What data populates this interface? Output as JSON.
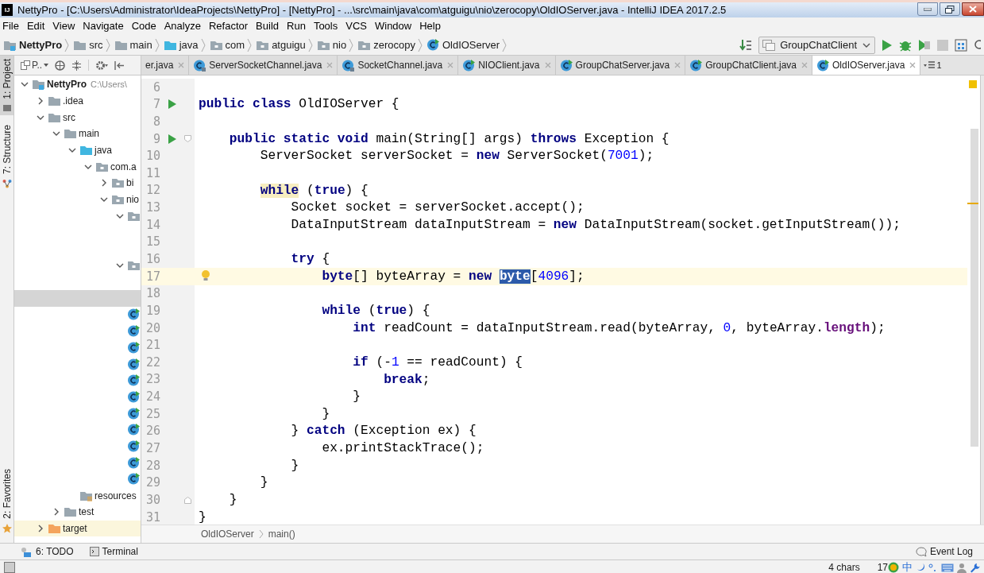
{
  "window": {
    "logo": "IJ",
    "title": "NettyPro - [C:\\Users\\Administrator\\IdeaProjects\\NettyPro] - [NettyPro] - ...\\src\\main\\java\\com\\atguigu\\nio\\zerocopy\\OldIOServer.java - IntelliJ IDEA 2017.2.5"
  },
  "menu": [
    "File",
    "Edit",
    "View",
    "Navigate",
    "Code",
    "Analyze",
    "Refactor",
    "Build",
    "Run",
    "Tools",
    "VCS",
    "Window",
    "Help"
  ],
  "nav_bar": {
    "crumbs": [
      {
        "label": "NettyPro",
        "kind": "project"
      },
      {
        "label": "src",
        "kind": "folder"
      },
      {
        "label": "main",
        "kind": "folder"
      },
      {
        "label": "java",
        "kind": "source"
      },
      {
        "label": "com",
        "kind": "package"
      },
      {
        "label": "atguigu",
        "kind": "package"
      },
      {
        "label": "nio",
        "kind": "package"
      },
      {
        "label": "zerocopy",
        "kind": "package"
      },
      {
        "label": "OldIOServer",
        "kind": "class"
      }
    ],
    "run_config": "GroupChatClient"
  },
  "tool_strip": {
    "top": [
      {
        "label": "1: Project",
        "selected": true,
        "kind": "project"
      },
      {
        "label": "7: Structure",
        "selected": false,
        "kind": "structure"
      }
    ],
    "bottom": [
      {
        "label": "2: Favorites",
        "selected": false,
        "kind": "favorites"
      }
    ]
  },
  "project_panel": {
    "view_label": "P..",
    "tree": [
      {
        "label": "NettyPro",
        "note": "C:\\Users\\",
        "kind": "project",
        "expanded": true,
        "selected": false,
        "children": [
          {
            "label": ".idea",
            "kind": "folder",
            "expanded": false,
            "selected": false
          },
          {
            "label": "src",
            "kind": "folder",
            "expanded": true,
            "selected": false,
            "children": [
              {
                "label": "main",
                "kind": "folder",
                "expanded": true,
                "selected": false,
                "children": [
                  {
                    "label": "java",
                    "kind": "source",
                    "expanded": true,
                    "selected": false,
                    "children": [
                      {
                        "label": "com.a",
                        "kind": "package",
                        "expanded": true,
                        "selected": false,
                        "children": [
                          {
                            "label": "bi",
                            "kind": "package",
                            "expanded": false,
                            "selected": false
                          },
                          {
                            "label": "nio",
                            "kind": "package",
                            "expanded": true,
                            "selected": false,
                            "children": [
                              {
                                "kind": "package",
                                "expanded": true,
                                "selected": false,
                                "children": [
                                  {
                                    "selected": false
                                  },
                                  {
                                    "selected": false
                                  }
                                ]
                              },
                              {
                                "kind": "package",
                                "expanded": true,
                                "selected": false,
                                "children": [
                                  {
                                    "selected": false
                                  },
                                  {
                                    "selected": true
                                  }
                                ]
                              },
                              {
                                "kind": "class",
                                "selected": false
                              },
                              {
                                "kind": "class",
                                "selected": false
                              },
                              {
                                "kind": "class",
                                "selected": false
                              },
                              {
                                "kind": "class",
                                "selected": false
                              },
                              {
                                "kind": "class",
                                "selected": false
                              },
                              {
                                "kind": "class",
                                "selected": false
                              },
                              {
                                "kind": "class",
                                "selected": false
                              },
                              {
                                "kind": "class",
                                "selected": false
                              },
                              {
                                "kind": "class",
                                "selected": false
                              },
                              {
                                "kind": "class",
                                "selected": false
                              },
                              {
                                "kind": "class",
                                "selected": false
                              }
                            ]
                          }
                        ]
                      }
                    ]
                  },
                  {
                    "label": "resources",
                    "kind": "resources",
                    "selected": false
                  }
                ]
              },
              {
                "label": "test",
                "kind": "folder",
                "expanded": false,
                "selected": false
              }
            ]
          },
          {
            "label": "target",
            "kind": "excluded",
            "expanded": false,
            "selected": false
          }
        ]
      }
    ]
  },
  "tabs": [
    {
      "label": "er.java",
      "selected": false
    },
    {
      "label": "ServerSocketChannel.java",
      "kind": "library",
      "selected": false
    },
    {
      "label": "SocketChannel.java",
      "kind": "library",
      "selected": false
    },
    {
      "label": "NIOClient.java",
      "kind": "runnable",
      "selected": false
    },
    {
      "label": "GroupChatServer.java",
      "kind": "runnable",
      "selected": false
    },
    {
      "label": "GroupChatClient.java",
      "kind": "runnable",
      "selected": false
    },
    {
      "label": "OldIOServer.java",
      "kind": "runnable",
      "selected": true
    }
  ],
  "tab_overflow": "1",
  "editor": {
    "lines": [
      {
        "number": "6",
        "current": false,
        "run": false,
        "fold_start": false,
        "fold_end": false,
        "bulb": false
      },
      {
        "number": "7",
        "current": false,
        "run": true,
        "fold_start": false,
        "fold_end": false,
        "bulb": false,
        "segments": [
          {
            "kind": "kw",
            "text": "public class"
          },
          {
            "kind": "p",
            "text": " OldIOServer {"
          }
        ]
      },
      {
        "number": "8",
        "current": false,
        "run": false,
        "fold_start": false,
        "fold_end": false,
        "bulb": false
      },
      {
        "number": "9",
        "current": false,
        "run": true,
        "fold_start": true,
        "fold_end": false,
        "bulb": false,
        "segments": [
          {
            "kind": "kw",
            "text": "    public static void"
          },
          {
            "kind": "p",
            "text": " main(String[] args) "
          },
          {
            "kind": "kw",
            "text": "throws"
          },
          {
            "kind": "p",
            "text": " Exception {"
          }
        ]
      },
      {
        "number": "10",
        "current": false,
        "run": false,
        "fold_start": false,
        "fold_end": false,
        "bulb": false,
        "segments": [
          {
            "kind": "p",
            "text": "        ServerSocket serverSocket = "
          },
          {
            "kind": "kw",
            "text": "new"
          },
          {
            "kind": "p",
            "text": " ServerSocket("
          },
          {
            "kind": "num",
            "text": "7001"
          },
          {
            "kind": "p",
            "text": ");"
          }
        ]
      },
      {
        "number": "11",
        "current": false,
        "run": false,
        "fold_start": false,
        "fold_end": false,
        "bulb": false
      },
      {
        "number": "12",
        "current": false,
        "run": false,
        "fold_start": false,
        "fold_end": false,
        "bulb": false,
        "segments": [
          {
            "kind": "kw_mark",
            "text": "        while"
          },
          {
            "kind": "p",
            "text": " ("
          },
          {
            "kind": "kw",
            "text": "true"
          },
          {
            "kind": "p",
            "text": ") {"
          }
        ]
      },
      {
        "number": "13",
        "current": false,
        "run": false,
        "fold_start": false,
        "fold_end": false,
        "bulb": false,
        "segments": [
          {
            "kind": "p",
            "text": "            Socket socket = serverSocket.accept();"
          }
        ]
      },
      {
        "number": "14",
        "current": false,
        "run": false,
        "fold_start": false,
        "fold_end": false,
        "bulb": false,
        "segments": [
          {
            "kind": "p",
            "text": "            DataInputStream dataInputStream = "
          },
          {
            "kind": "kw",
            "text": "new"
          },
          {
            "kind": "p",
            "text": " DataInputStream(socket.getInputStream());"
          }
        ]
      },
      {
        "number": "15",
        "current": false,
        "run": false,
        "fold_start": false,
        "fold_end": false,
        "bulb": false
      },
      {
        "number": "16",
        "current": false,
        "run": false,
        "fold_start": false,
        "fold_end": false,
        "bulb": false,
        "segments": [
          {
            "kind": "kw",
            "text": "            try"
          },
          {
            "kind": "p",
            "text": " {"
          }
        ]
      },
      {
        "number": "17",
        "current": true,
        "run": false,
        "fold_start": false,
        "fold_end": false,
        "bulb": true,
        "segments": [
          {
            "kind": "kw",
            "text": "                byte"
          },
          {
            "kind": "p",
            "text": "[] byteArray = "
          },
          {
            "kind": "kw",
            "text": "new "
          },
          {
            "kind": "sel",
            "text": "byte"
          },
          {
            "kind": "p",
            "text": "["
          },
          {
            "kind": "num",
            "text": "4096"
          },
          {
            "kind": "p",
            "text": "];"
          }
        ]
      },
      {
        "number": "18",
        "current": false,
        "run": false,
        "fold_start": false,
        "fold_end": false,
        "bulb": false
      },
      {
        "number": "19",
        "current": false,
        "run": false,
        "fold_start": false,
        "fold_end": false,
        "bulb": false,
        "segments": [
          {
            "kind": "kw",
            "text": "                while"
          },
          {
            "kind": "p",
            "text": " ("
          },
          {
            "kind": "kw",
            "text": "true"
          },
          {
            "kind": "p",
            "text": ") {"
          }
        ]
      },
      {
        "number": "20",
        "current": false,
        "run": false,
        "fold_start": false,
        "fold_end": false,
        "bulb": false,
        "segments": [
          {
            "kind": "kw",
            "text": "                    int"
          },
          {
            "kind": "p",
            "text": " readCount = dataInputStream.read(byteArray, "
          },
          {
            "kind": "num",
            "text": "0"
          },
          {
            "kind": "p",
            "text": ", byteArray."
          },
          {
            "kind": "fld",
            "text": "length"
          },
          {
            "kind": "p",
            "text": ");"
          }
        ]
      },
      {
        "number": "21",
        "current": false,
        "run": false,
        "fold_start": false,
        "fold_end": false,
        "bulb": false
      },
      {
        "number": "22",
        "current": false,
        "run": false,
        "fold_start": false,
        "fold_end": false,
        "bulb": false,
        "segments": [
          {
            "kind": "kw",
            "text": "                    if"
          },
          {
            "kind": "p",
            "text": " (-"
          },
          {
            "kind": "num",
            "text": "1"
          },
          {
            "kind": "p",
            "text": " == readCount) {"
          }
        ]
      },
      {
        "number": "23",
        "current": false,
        "run": false,
        "fold_start": false,
        "fold_end": false,
        "bulb": false,
        "segments": [
          {
            "kind": "kw",
            "text": "                        break"
          },
          {
            "kind": "p",
            "text": ";"
          }
        ]
      },
      {
        "number": "24",
        "current": false,
        "run": false,
        "fold_start": false,
        "fold_end": false,
        "bulb": false,
        "segments": [
          {
            "kind": "p",
            "text": "                    }"
          }
        ]
      },
      {
        "number": "25",
        "current": false,
        "run": false,
        "fold_start": false,
        "fold_end": false,
        "bulb": false,
        "segments": [
          {
            "kind": "p",
            "text": "                }"
          }
        ]
      },
      {
        "number": "26",
        "current": false,
        "run": false,
        "fold_start": false,
        "fold_end": false,
        "bulb": false,
        "segments": [
          {
            "kind": "p",
            "text": "            } "
          },
          {
            "kind": "kw",
            "text": "catch"
          },
          {
            "kind": "p",
            "text": " (Exception ex) {"
          }
        ]
      },
      {
        "number": "27",
        "current": false,
        "run": false,
        "fold_start": false,
        "fold_end": false,
        "bulb": false,
        "segments": [
          {
            "kind": "p",
            "text": "                ex.printStackTrace();"
          }
        ]
      },
      {
        "number": "28",
        "current": false,
        "run": false,
        "fold_start": false,
        "fold_end": false,
        "bulb": false,
        "segments": [
          {
            "kind": "p",
            "text": "            }"
          }
        ]
      },
      {
        "number": "29",
        "current": false,
        "run": false,
        "fold_start": false,
        "fold_end": false,
        "bulb": false,
        "segments": [
          {
            "kind": "p",
            "text": "        }"
          }
        ]
      },
      {
        "number": "30",
        "current": false,
        "run": false,
        "fold_start": false,
        "fold_end": true,
        "bulb": false,
        "segments": [
          {
            "kind": "p",
            "text": "    }"
          }
        ]
      },
      {
        "number": "31",
        "current": false,
        "run": false,
        "fold_start": false,
        "fold_end": false,
        "bulb": false,
        "segments": [
          {
            "kind": "p",
            "text": "}"
          }
        ]
      }
    ],
    "breadcrumbs": [
      "OldIOServer",
      "main()"
    ]
  },
  "tool_bar": {
    "left": [
      {
        "label": "6: TODO",
        "kind": "todo"
      },
      {
        "label": "Terminal",
        "kind": "terminal"
      }
    ],
    "right": {
      "label": "Event Log"
    }
  },
  "status_bar": {
    "selection": "4 chars",
    "line": "17",
    "ime": "中"
  }
}
